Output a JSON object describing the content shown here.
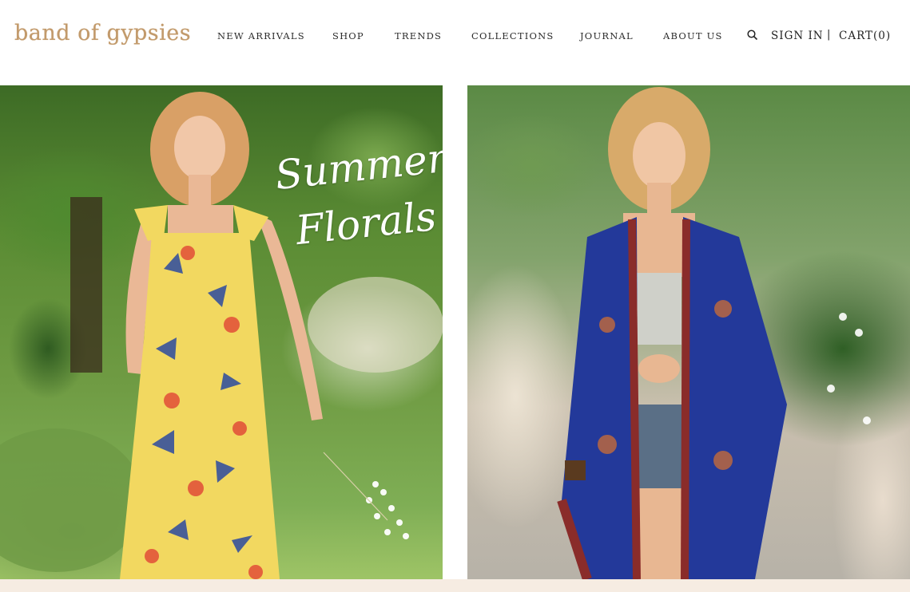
{
  "brand": {
    "logo_text": "band of gypsies",
    "logo_color": "#c29a6b"
  },
  "nav": {
    "items": [
      {
        "label": "NEW ARRIVALS"
      },
      {
        "label": "SHOP"
      },
      {
        "label": "TRENDS"
      },
      {
        "label": "COLLECTIONS"
      },
      {
        "label": "JOURNAL"
      },
      {
        "label": "ABOUT US"
      }
    ]
  },
  "utility": {
    "search_icon": "search-icon",
    "sign_in_label": "SIGN IN",
    "separator": "|",
    "cart_label": "CART(0)"
  },
  "hero": {
    "left": {
      "headline_line1": "Summer",
      "headline_line2": "Florals"
    },
    "right": {}
  },
  "colors": {
    "accent": "#c29a6b",
    "nav_text": "#2b2b2b",
    "footer_strip": "#f6ece2"
  }
}
